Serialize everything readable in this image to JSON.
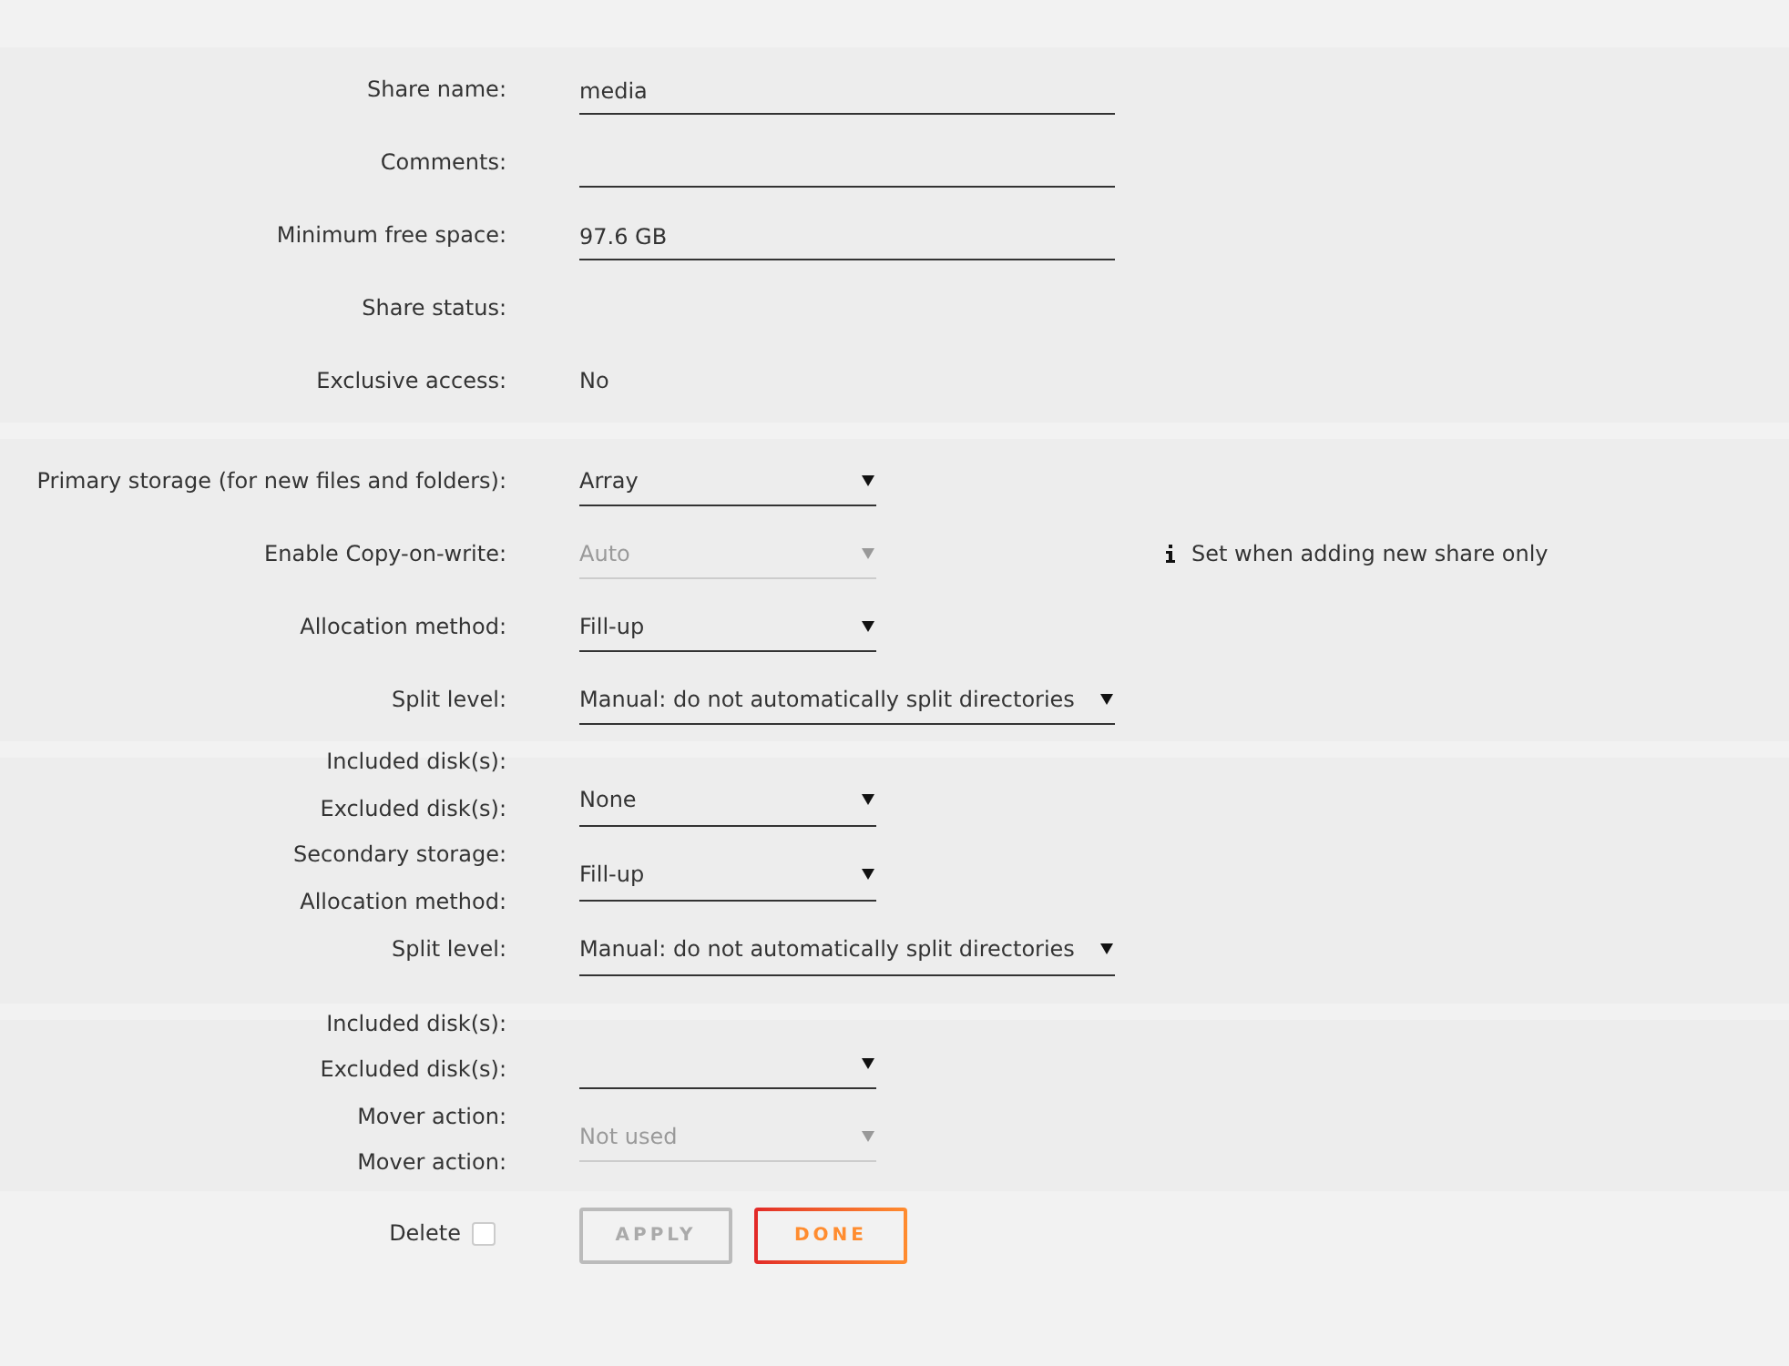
{
  "sections": [
    {
      "rows": [
        {
          "label": "Share name:",
          "field": {
            "kind": "text",
            "value": "media",
            "disabled": false
          }
        },
        {
          "label": "Comments:",
          "field": {
            "kind": "text",
            "disabled": false
          }
        },
        {
          "label": "Minimum free space:",
          "field": {
            "kind": "text",
            "value": "97.6 GB",
            "disabled": false
          }
        },
        {
          "label": "Share status:"
        },
        {
          "label": "Exclusive access:",
          "field": {
            "kind": "static",
            "value": "No"
          }
        }
      ]
    },
    {
      "rows": [
        {
          "label": "Primary storage (for new files and folders):",
          "field": {
            "kind": "select",
            "value": "Array",
            "disabled": false
          }
        },
        {
          "label": "Enable Copy-on-write:",
          "field": {
            "kind": "select",
            "value": "Auto",
            "disabled": true
          },
          "note": "Set when adding new share only"
        },
        {
          "label": "Allocation method:",
          "field": {
            "kind": "select",
            "value": "Fill-up",
            "disabled": false
          }
        },
        {
          "label": "Split level:",
          "field": {
            "kind": "select",
            "value": "Manual: do not automatically split directories",
            "disabled": false
          }
        }
      ]
    },
    {
      "labels": [
        "Included disk(s):",
        "Excluded disk(s):",
        "Secondary storage:",
        "Allocation method:",
        "Split level:"
      ],
      "fields": [
        {
          "kind": "select",
          "value": "None",
          "disabled": false
        },
        {
          "kind": "select",
          "value": "Fill-up",
          "disabled": false
        },
        {
          "kind": "select",
          "value": "Manual: do not automatically split directories",
          "disabled": false
        }
      ]
    },
    {
      "labels": [
        "Included disk(s):",
        "Excluded disk(s):",
        "Mover action:",
        "Mover action:"
      ],
      "fields": [
        {
          "kind": "select",
          "disabled": false
        },
        {
          "kind": "select",
          "value": "Not used",
          "disabled": true
        }
      ]
    }
  ],
  "delete": {
    "label": "Delete",
    "checked": false
  },
  "buttons": [
    {
      "label": "APPLY",
      "disabled": true
    },
    {
      "label": "DONE",
      "disabled": false
    }
  ]
}
